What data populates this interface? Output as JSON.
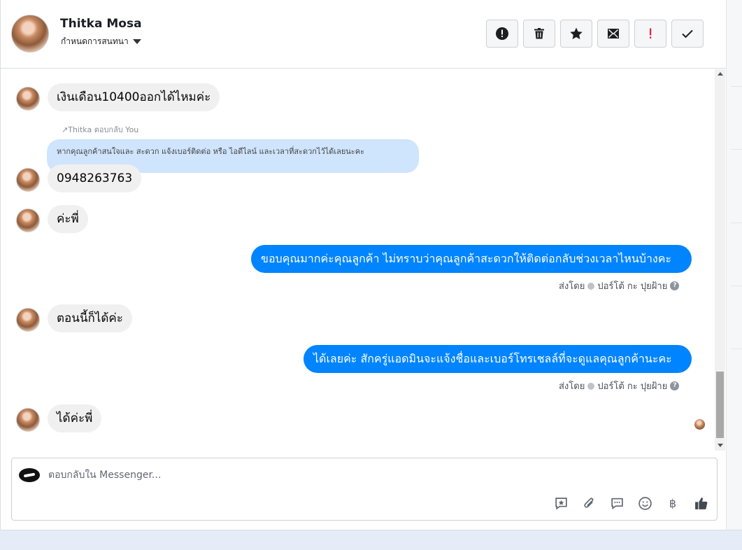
{
  "header": {
    "contact_name": "Thitka Mosa",
    "assign_label": "กำหนดการสนทนา",
    "actions": [
      "mark-spam",
      "delete",
      "star",
      "move-to-inbox",
      "follow-up",
      "mark-done"
    ]
  },
  "messages": {
    "m1": "เงินเดือน10400ออกได้ไหมค่ะ",
    "reply_note": "Thitka ตอบกลับ You",
    "reply_quote": "หากคุณลูกค้าสนใจและ สะดวก แจ้งเบอร์ติดต่อ หรือ ไอดีไลน์ และเวลาที่สะดวกไว้ได้เลยนะคะ",
    "m2": "0948263763",
    "m3": "ค่ะพี่",
    "out1": "ขอบคุณมากค่ะคุณลูกค้า ไม่ทราบว่าคุณลูกค้าสะดวกให้ติดต่อกลับช่วงเวลาไหนบ้างคะ",
    "sent_by_1": "ส่งโดย",
    "sender_1": "ปอร์โต้ กะ ปุยฝ้าย",
    "m4": "ตอนนี้ก็ได้ค่ะ",
    "out2": "ได้เลยค่ะ สักครู่แอดมินจะแจ้งชื่อและเบอร์โทรเชลล์ที่จะดูแลคุณลูกค้านะคะ",
    "sent_by_2": "ส่งโดย",
    "sender_2": "ปอร์โต้ กะ ปุยฝ้าย",
    "m5": "ได้ค่ะพี่"
  },
  "composer": {
    "placeholder": "ตอบกลับใน Messenger...",
    "currency_symbol": "฿",
    "tools": [
      "saved-reply-icon",
      "attachment-icon",
      "chat-icon",
      "emoji-icon",
      "currency-icon",
      "like-icon"
    ]
  },
  "colors": {
    "outgoing_bubble": "#0084ff",
    "incoming_bubble": "#f0f0f0",
    "quote_bubble": "#cfe4fd",
    "follow_up_red": "#e41e3f"
  }
}
